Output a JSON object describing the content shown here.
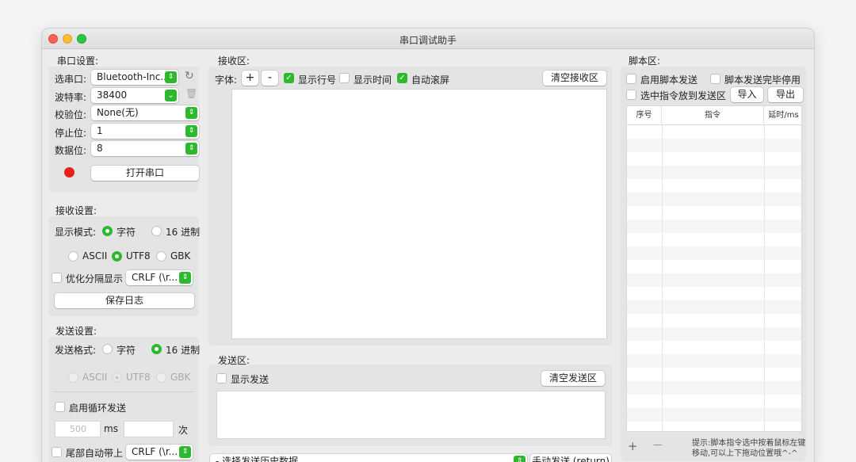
{
  "window": {
    "title": "串口调试助手"
  },
  "serial": {
    "section": "串口设置:",
    "port_label": "选串口:",
    "port_value": "Bluetooth-Inc...",
    "baud_label": "波特率:",
    "baud_value": "38400",
    "parity_label": "校验位:",
    "parity_value": "None(无)",
    "stop_label": "停止位:",
    "stop_value": "1",
    "data_label": "数据位:",
    "data_value": "8",
    "open_button": "打开串口",
    "status_color": "#e8201b"
  },
  "recv_settings": {
    "section": "接收设置:",
    "mode_label": "显示模式:",
    "mode_char": "字符",
    "mode_hex": "16 进制",
    "enc_ascii": "ASCII",
    "enc_utf8": "UTF8",
    "enc_gbk": "GBK",
    "optimize_label": "优化分隔显示",
    "optimize_value": "CRLF (\\r...",
    "save_log": "保存日志"
  },
  "send_settings": {
    "section": "发送设置:",
    "format_label": "发送格式:",
    "fmt_char": "字符",
    "fmt_hex": "16 进制",
    "enc_ascii": "ASCII",
    "enc_utf8": "UTF8",
    "enc_gbk": "GBK",
    "loop_label": "启用循环发送",
    "interval_placeholder": "500",
    "ms_label": "ms",
    "count_suffix": "次",
    "tail_label": "尾部自动带上",
    "tail_value": "CRLF (\\r..."
  },
  "receive": {
    "section": "接收区:",
    "font_label": "字体:",
    "font_plus": "+",
    "font_minus": "-",
    "show_line": "显示行号",
    "show_time": "显示时间",
    "auto_scroll": "自动滚屏",
    "clear": "清空接收区"
  },
  "send": {
    "section": "发送区:",
    "show_send": "显示发送",
    "clear": "清空发送区",
    "history_label": "- 选择发送历史数据",
    "manual_send": "手动发送 (return)"
  },
  "script": {
    "section": "脚本区:",
    "enable": "启用脚本发送",
    "stop_after": "脚本发送完毕停用",
    "put_selected": "选中指令放到发送区",
    "import": "导入",
    "export": "导出",
    "columns": [
      "序号",
      "指令",
      "延时/ms"
    ],
    "add": "+",
    "remove": "—",
    "hint_line1": "提示:脚本指令选中按着鼠标左键",
    "hint_line2": "移动,可以上下拖动位置哦^-^"
  },
  "colors": {
    "accent": "#2eb82e",
    "status_red": "#e8201b"
  }
}
